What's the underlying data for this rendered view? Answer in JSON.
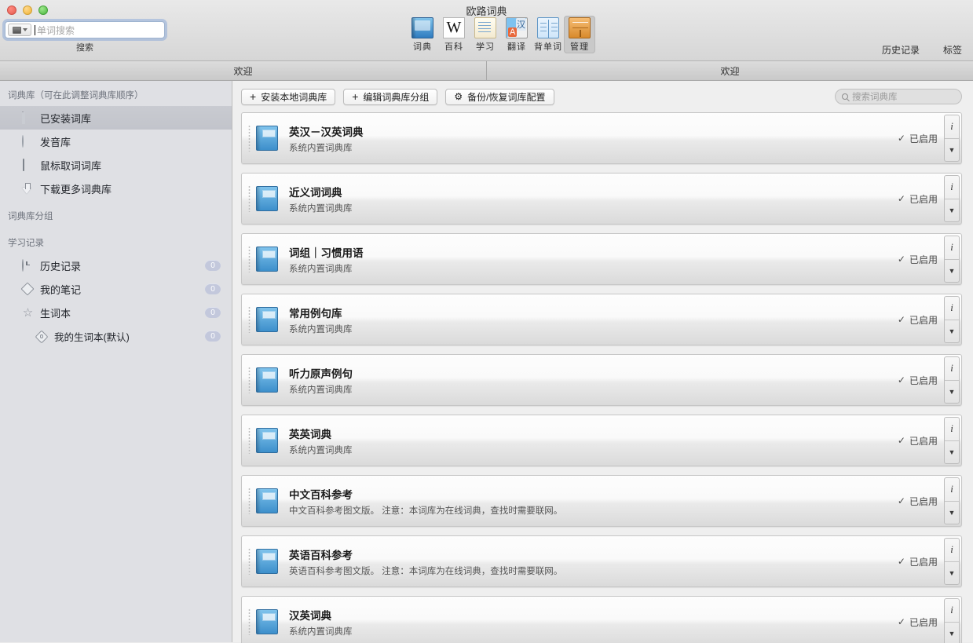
{
  "window": {
    "app_title": "欧路词典",
    "traffic_lights": [
      "close",
      "minimize",
      "zoom"
    ]
  },
  "search": {
    "placeholder": "单词搜索",
    "value": "",
    "label": "搜索",
    "mode_icon": "keyboard-icon"
  },
  "toolbar": {
    "items": [
      {
        "label": "词典",
        "icon": "dictionary-icon",
        "selected": false
      },
      {
        "label": "百科",
        "icon": "wikipedia-icon",
        "selected": false
      },
      {
        "label": "学习",
        "icon": "study-notepad-icon",
        "selected": false
      },
      {
        "label": "翻译",
        "icon": "translate-icon",
        "selected": false
      },
      {
        "label": "背单词",
        "icon": "open-book-icon",
        "selected": false
      },
      {
        "label": "管理",
        "icon": "manage-drawer-icon",
        "selected": true
      }
    ],
    "right_links": [
      {
        "label": "历史记录"
      },
      {
        "label": "标签"
      }
    ]
  },
  "tabs": {
    "left_tab": "欢迎",
    "right_tab": "欢迎"
  },
  "sidebar": {
    "header": "词典库（可在此调整词典库顺序）",
    "groups_header": "词典库分组",
    "study_header": "学习记录",
    "items": [
      {
        "label": "已安装词库",
        "icon": "book-square-icon",
        "selected": true,
        "badge": null
      },
      {
        "label": "发音库",
        "icon": "sound-circle-icon",
        "selected": false,
        "badge": null
      },
      {
        "label": "鼠标取词词库",
        "icon": "mouse-icon",
        "selected": false,
        "badge": null
      },
      {
        "label": "下载更多词典库",
        "icon": "download-arrow-icon",
        "selected": false,
        "badge": null
      }
    ],
    "study_items": [
      {
        "label": "历史记录",
        "icon": "clock-icon",
        "badge": "0",
        "child": false
      },
      {
        "label": "我的笔记",
        "icon": "note-diamond-icon",
        "badge": "0",
        "child": false
      },
      {
        "label": "生词本",
        "icon": "star-icon",
        "badge": "0",
        "child": false
      },
      {
        "label": "我的生词本(默认)",
        "icon": "tag-icon",
        "badge": "0",
        "child": true
      }
    ]
  },
  "main": {
    "buttons": [
      {
        "label": "安装本地词典库",
        "icon": "plus-icon"
      },
      {
        "label": "编辑词典库分组",
        "icon": "plus-icon"
      },
      {
        "label": "备份/恢复词库配置",
        "icon": "gear-icon"
      }
    ],
    "search_placeholder": "搜索词典库",
    "search_value": "",
    "enabled_label": "已启用",
    "info_glyph": "i",
    "menu_glyph": "▼",
    "dictionaries": [
      {
        "title": "英汉－汉英词典",
        "desc": "系统内置词典库",
        "enabled": "已启用"
      },
      {
        "title": "近义词词典",
        "desc": "系统内置词典库",
        "enabled": "已启用"
      },
      {
        "title": "词组｜习惯用语",
        "desc": "系统内置词典库",
        "enabled": "已启用"
      },
      {
        "title": "常用例句库",
        "desc": "系统内置词典库",
        "enabled": "已启用"
      },
      {
        "title": "听力原声例句",
        "desc": "系统内置词典库",
        "enabled": "已启用"
      },
      {
        "title": "英英词典",
        "desc": "系统内置词典库",
        "enabled": "已启用"
      },
      {
        "title": "中文百科参考",
        "desc": "中文百科参考图文版。 注意：本词库为在线词典，查找时需要联网。",
        "enabled": "已启用"
      },
      {
        "title": "英语百科参考",
        "desc": "英语百科参考图文版。 注意：本词库为在线词典，查找时需要联网。",
        "enabled": "已启用"
      },
      {
        "title": "汉英词典",
        "desc": "系统内置词典库",
        "enabled": "已启用"
      }
    ]
  },
  "colors": {
    "accent_blue": "#3d8fcb",
    "selected_tool": "#c9c9c9",
    "sidebar_bg": "#dfe0e4",
    "badge_bg": "#c3c8dc"
  }
}
